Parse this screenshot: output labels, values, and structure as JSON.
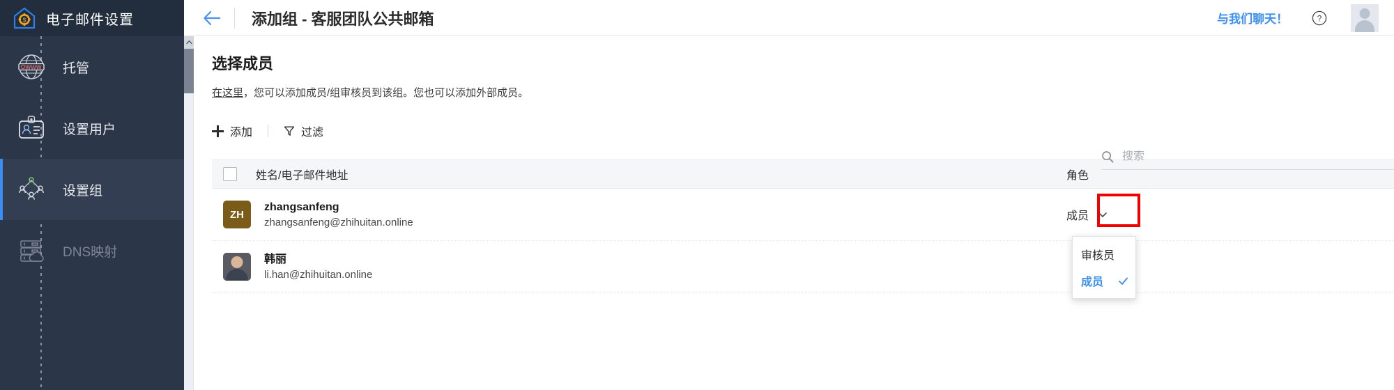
{
  "sidebar": {
    "brand_title": "电子邮件设置",
    "brand_logo_icon": "house-gear-icon",
    "items": [
      {
        "label": "托管",
        "icon": "globe-www-icon",
        "active": false,
        "disabled": false
      },
      {
        "label": "设置用户",
        "icon": "id-card-user-icon",
        "active": false,
        "disabled": false
      },
      {
        "label": "设置组",
        "icon": "group-network-icon",
        "active": true,
        "disabled": false
      },
      {
        "label": "DNS映射",
        "icon": "server-cloud-icon",
        "active": false,
        "disabled": true
      }
    ]
  },
  "topbar": {
    "back_icon": "back-arrow-icon",
    "title": "添加组 - 客服团队公共邮箱",
    "chat_label": "与我们聊天！",
    "help_icon": "question-mark-icon",
    "avatar_icon": "user-avatar-icon"
  },
  "content": {
    "section_title": "选择成员",
    "description_link": "在这里",
    "description_rest": "，您可以添加成员/组审核员到该组。您也可以添加外部成员。",
    "toolbar": {
      "add_label": "添加",
      "add_icon": "plus-icon",
      "filter_label": "过滤",
      "filter_icon": "funnel-icon"
    },
    "search": {
      "placeholder": "搜索",
      "value": "",
      "icon": "search-icon"
    },
    "table": {
      "columns": {
        "name_email": "姓名/电子邮件地址",
        "role": "角色"
      },
      "rows": [
        {
          "avatar_initials": "ZH",
          "avatar_color": "#7a5c18",
          "avatar_type": "initials",
          "name": "zhangsanfeng",
          "email": "zhangsanfeng@zhihuitan.online",
          "role": "成员",
          "highlighted": true
        },
        {
          "avatar_initials": "",
          "avatar_color": "#5a5a62",
          "avatar_type": "photo",
          "name": "韩丽",
          "email": "li.han@zhihuitan.online",
          "role": "",
          "highlighted": false
        }
      ]
    },
    "role_dropdown": {
      "open": true,
      "options": [
        {
          "label": "审核员",
          "selected": false
        },
        {
          "label": "成员",
          "selected": true
        }
      ]
    }
  },
  "colors": {
    "sidebar_bg": "#2b3648",
    "brand_bg": "#222d3e",
    "accent_blue": "#3b8ff0",
    "active_bar": "#3b8ff0",
    "highlight_red": "#f00000",
    "avatar_brown": "#7a5c18"
  }
}
